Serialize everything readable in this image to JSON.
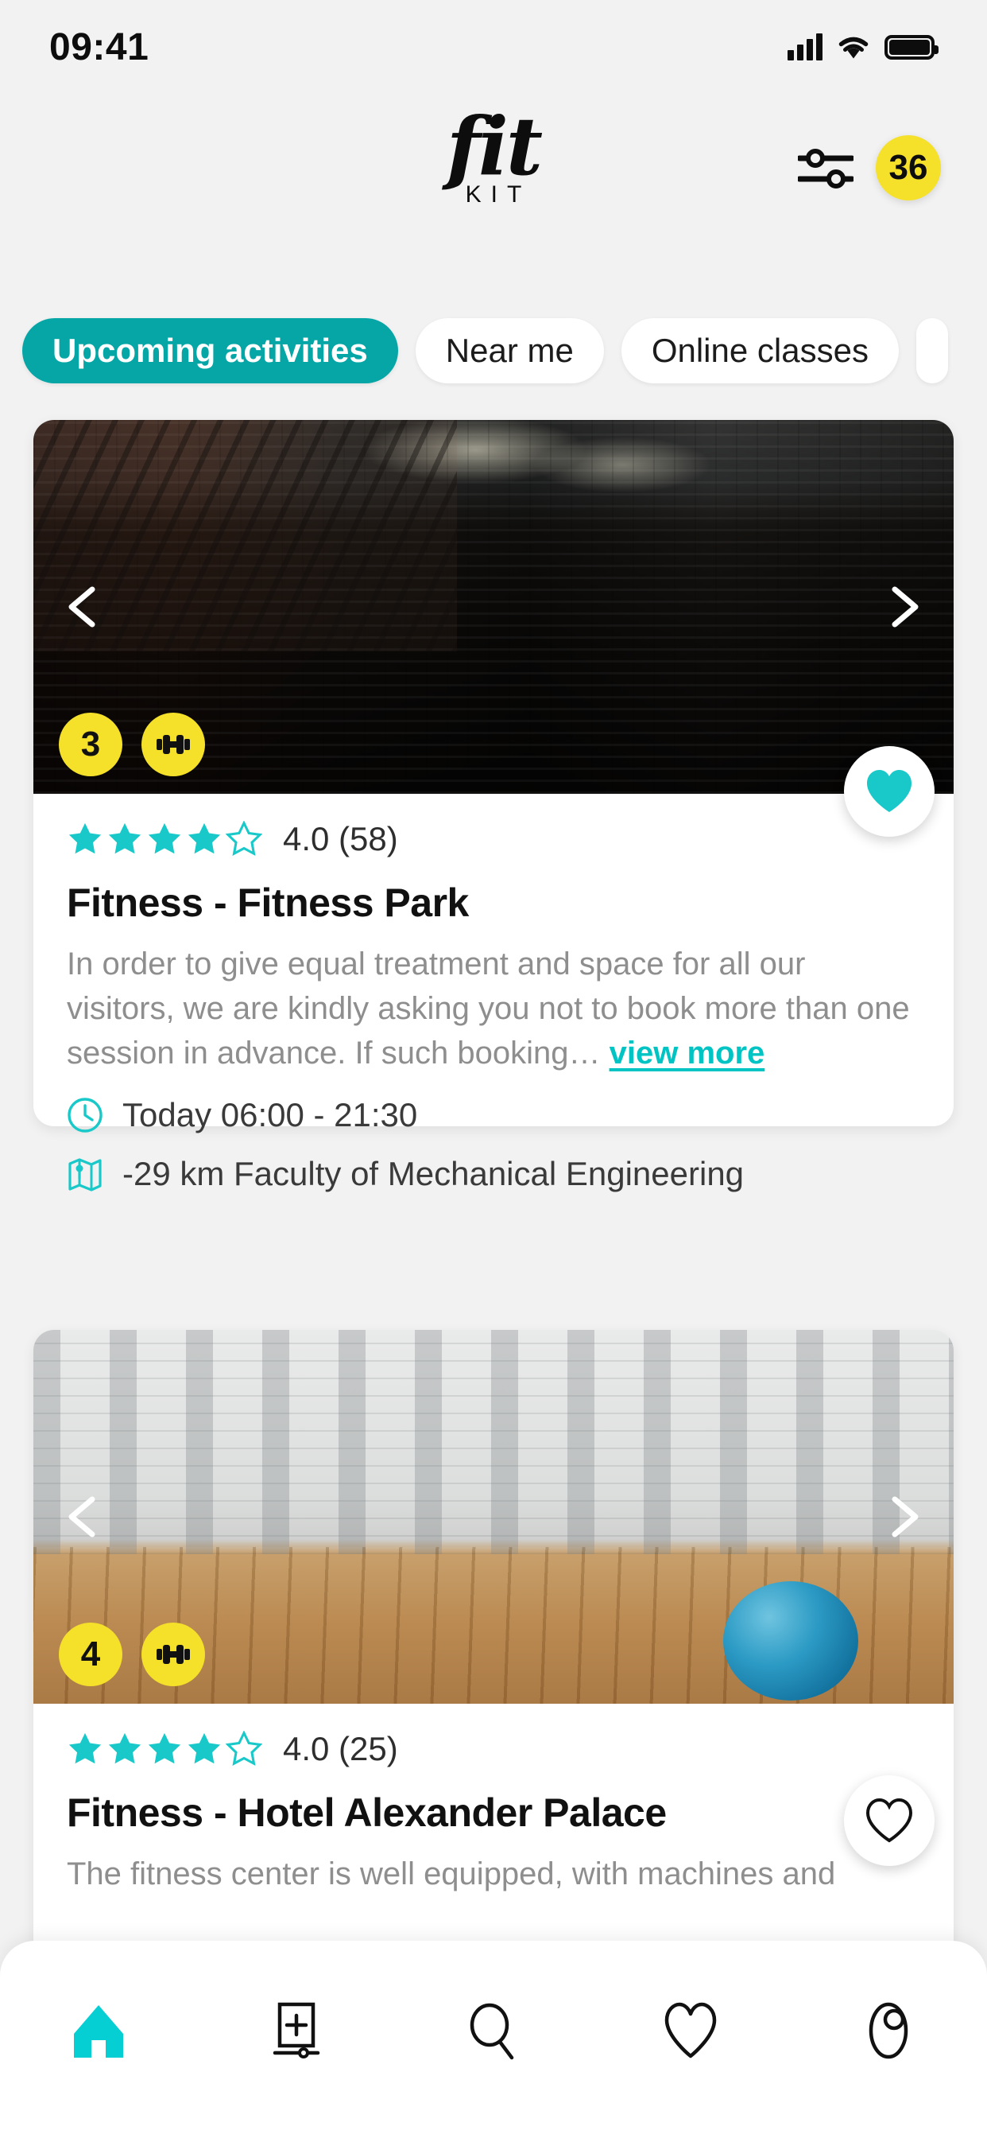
{
  "status_bar": {
    "time": "09:41",
    "signal_icon": "cellular-signal-icon",
    "wifi_icon": "wifi-icon",
    "battery_icon": "battery-full-icon"
  },
  "header": {
    "logo_primary": "fit",
    "logo_secondary": "KIT",
    "filter_icon": "filter-sliders-icon",
    "count_badge": "36",
    "badge_color": "#f5e02a"
  },
  "tabs": [
    {
      "label": "Upcoming activities",
      "active": true
    },
    {
      "label": "Near me",
      "active": false
    },
    {
      "label": "Online classes",
      "active": false
    },
    {
      "label": "",
      "active": false
    }
  ],
  "colors": {
    "accent_teal": "#06a6a6",
    "accent_cyan": "#00c4c4",
    "badge_yellow": "#f5e02a",
    "page_background": "#f2f2f2",
    "card_background": "#ffffff"
  },
  "cards": [
    {
      "photo_count_badge": "3",
      "activity_icon": "dumbbell-icon",
      "favorite": true,
      "favorite_icon": "heart-filled-icon",
      "prev_arrow_icon": "chevron-left-icon",
      "next_arrow_icon": "chevron-right-icon",
      "stars_filled": 4,
      "stars_total": 5,
      "rating_text": "4.0 (58)",
      "title": "Fitness - Fitness Park",
      "description": "In order to give equal treatment and space for all our visitors, we are kindly asking you not to book more than one session in advance. If such booking… ",
      "view_more_label": "view more",
      "time_icon": "clock-icon",
      "time_text": "Today 06:00 - 21:30",
      "location_icon": "map-icon",
      "location_text": "-29 km Faculty of Mechanical Engineering"
    },
    {
      "photo_count_badge": "4",
      "activity_icon": "dumbbell-icon",
      "favorite": false,
      "favorite_icon": "heart-outline-icon",
      "prev_arrow_icon": "chevron-left-icon",
      "next_arrow_icon": "chevron-right-icon",
      "stars_filled": 4,
      "stars_total": 5,
      "rating_text": "4.0 (25)",
      "title": "Fitness - Hotel Alexander Palace",
      "description": "The fitness center is well equipped, with machines and"
    }
  ],
  "bottom_nav": [
    {
      "icon": "home-icon",
      "active": true
    },
    {
      "icon": "add-activity-icon",
      "active": false
    },
    {
      "icon": "search-icon",
      "active": false
    },
    {
      "icon": "heart-icon",
      "active": false
    },
    {
      "icon": "profile-icon",
      "active": false
    }
  ]
}
